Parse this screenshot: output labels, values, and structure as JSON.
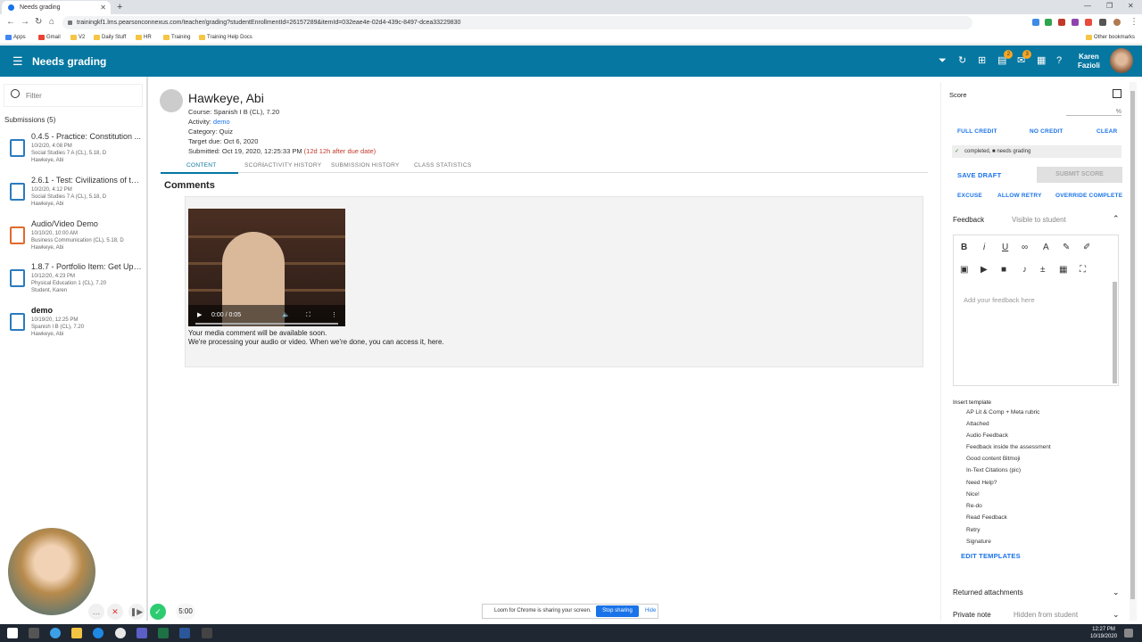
{
  "browser": {
    "tab_title": "Needs grading",
    "url": "trainingkf1.lms.pearsonconnexus.com/teacher/grading?studentEnrollmentId=26157289&itemId=032eae4e-02d4-439c-8497-dcea33229830",
    "bookmarks": [
      "Apps",
      "Gmail",
      "V2",
      "Daily Stuff",
      "HR",
      "Training",
      "Training Help Docs"
    ],
    "other_bookmarks": "Other bookmarks"
  },
  "app": {
    "title": "Needs grading",
    "badge1": "2",
    "badge2": "3",
    "user_first": "Karen",
    "user_last": "Fazioli"
  },
  "left": {
    "filter_placeholder": "Filter",
    "submissions_label": "Submissions (5)",
    "items": [
      {
        "title": "0.4.5 - Practice: Constitution ...",
        "date": "10/2/20, 4:08 PM",
        "course": "Social Studies 7 A (CL), 5.18, D",
        "student": "Hawkeye, Abi"
      },
      {
        "title": "2.6.1 - Test: Civilizations of th...",
        "date": "10/2/20, 4:12 PM",
        "course": "Social Studies 7 A (CL), 5.18, D",
        "student": "Hawkeye, Abi"
      },
      {
        "title": "Audio/Video Demo",
        "date": "10/10/20, 10:00 AM",
        "course": "Business Communication (CL), 5.18, D",
        "student": "Hawkeye, Abi"
      },
      {
        "title": "1.8.7 - Portfolio Item: Get Up ...",
        "date": "10/12/20, 4:23 PM",
        "course": "Physical Education 1 (CL), 7.20",
        "student": "Student, Karen"
      },
      {
        "title": "demo",
        "date": "10/19/20, 12:25 PM",
        "course": "Spanish I B (CL), 7.20",
        "student": "Hawkeye, Abi"
      }
    ]
  },
  "main": {
    "student_name": "Hawkeye, Abi",
    "course": "Course: Spanish I B (CL), 7.20",
    "activity_label": "Activity: ",
    "activity_link": "demo",
    "category": "Category: Quiz",
    "target_due": "Target due: Oct 6, 2020",
    "submitted": "Submitted: Oct 19, 2020, 12:25:33 PM",
    "late": "(12d 12h after due date)",
    "tabs": [
      "CONTENT",
      "SCORE",
      "ACTIVITY HISTORY",
      "SUBMISSION HISTORY",
      "CLASS STATISTICS"
    ],
    "comments_heading": "Comments",
    "video_time": "0:00 / 0:05",
    "msg1": "Your media comment will be available soon.",
    "msg2": "We're processing your audio or video. When we're done, you can access it, here."
  },
  "right": {
    "score_label": "Score",
    "percent": "%",
    "full_credit": "FULL CREDIT",
    "no_credit": "NO CREDIT",
    "clear": "CLEAR",
    "status_completed": "completed,",
    "status_grading": "needs grading",
    "save_draft": "SAVE DRAFT",
    "submit_score": "SUBMIT SCORE",
    "excuse": "EXCUSE",
    "allow_retry": "ALLOW RETRY",
    "override_complete": "OVERRIDE COMPLETE",
    "feedback_label": "Feedback",
    "visibility": "Visible to student",
    "feedback_placeholder": "Add your feedback here",
    "insert_template": "Insert template",
    "templates": [
      "AP Lit & Comp + Meta rubric",
      "Attached",
      "Audio Feedback",
      "Feedback inside the assessment",
      "Good content Bitmoji",
      "In-Text Citations (pic)",
      "Need Help?",
      "Nice!",
      "Re-do",
      "Read Feedback",
      "Retry",
      "Signature"
    ],
    "edit_templates": "EDIT TEMPLATES",
    "returned_attachments": "Returned attachments",
    "private_note": "Private note",
    "private_hint": "Hidden from student"
  },
  "loom": {
    "timer": "5:00",
    "share_text": "Loom for Chrome is sharing your screen.",
    "stop_sharing": "Stop sharing",
    "hide": "Hide"
  },
  "taskbar": {
    "time": "12:27 PM",
    "date": "10/19/2020"
  },
  "colors": {
    "app_bar": "#0577a1",
    "link": "#1a73e8",
    "late": "#c0392b"
  }
}
